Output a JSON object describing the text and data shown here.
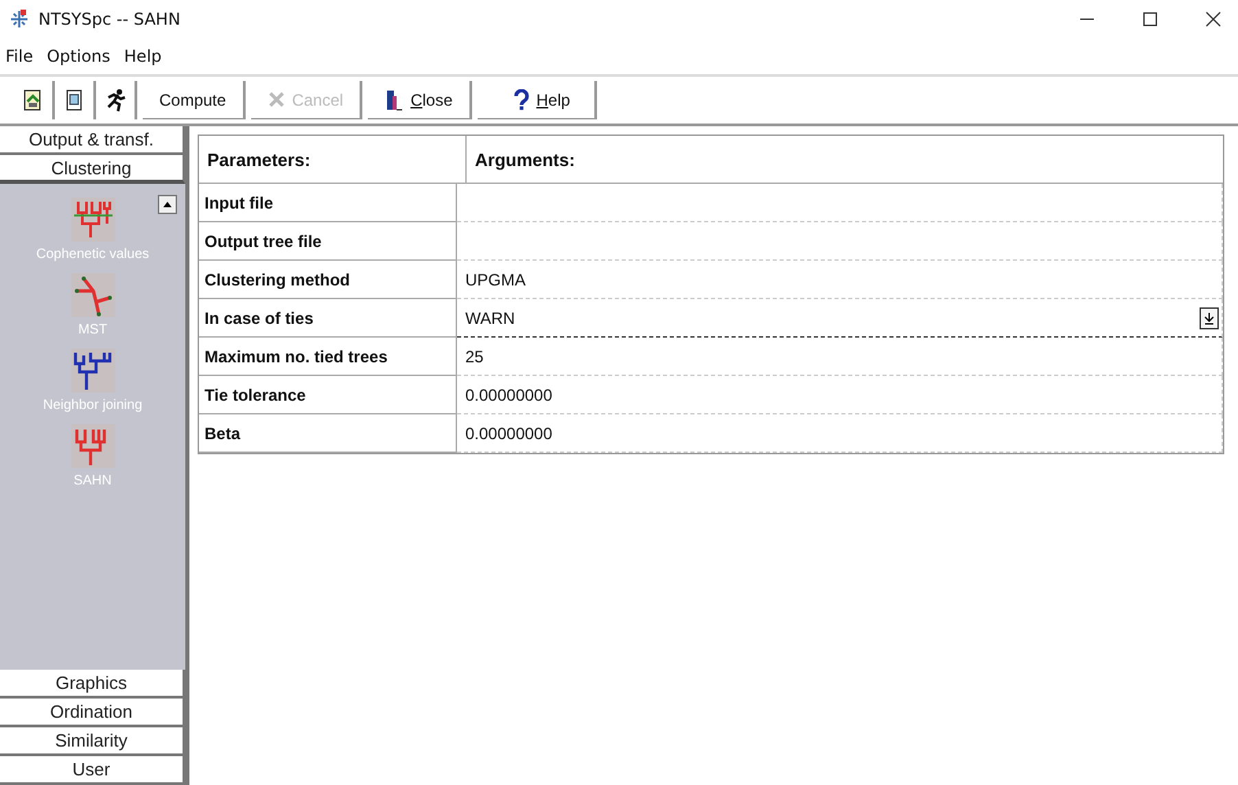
{
  "window": {
    "title": "NTSYSpc -- SAHN"
  },
  "menu": [
    "File",
    "Options",
    "Help"
  ],
  "toolbar": {
    "icon_buttons": [
      {
        "kind": "import"
      },
      {
        "kind": "notepad"
      },
      {
        "kind": "run"
      }
    ],
    "buttons": [
      {
        "label": "Compute",
        "kind": "plain",
        "disabled": false,
        "underline_first": false
      },
      {
        "label": "Cancel",
        "kind": "cancel",
        "disabled": true,
        "underline_first": false
      },
      {
        "label": "Close",
        "kind": "close",
        "disabled": false,
        "underline_first": true
      },
      {
        "label": "Help",
        "kind": "help",
        "disabled": false,
        "underline_first": true
      }
    ]
  },
  "sidebar": {
    "groups": [
      {
        "label": "Output & transf.",
        "expanded": false
      },
      {
        "label": "Clustering",
        "expanded": true,
        "items": [
          {
            "label": "Cophenetic values",
            "kind": "cophenetic"
          },
          {
            "label": "MST",
            "kind": "mst"
          },
          {
            "label": "Neighbor joining",
            "kind": "nj"
          },
          {
            "label": "SAHN",
            "kind": "sahn"
          }
        ]
      },
      {
        "label": "Graphics",
        "expanded": false
      },
      {
        "label": "Ordination",
        "expanded": false
      },
      {
        "label": "Similarity",
        "expanded": false
      },
      {
        "label": "User",
        "expanded": false
      }
    ]
  },
  "table": {
    "columns": [
      "Parameters:",
      "Arguments:"
    ],
    "rows": [
      {
        "parameter": "Input file",
        "kind": "text",
        "focused": false
      },
      {
        "parameter": "Output tree file",
        "kind": "text",
        "focused": false
      },
      {
        "parameter": "Clustering method",
        "argument": "UPGMA",
        "kind": "text",
        "focused": false
      },
      {
        "parameter": "In case of ties",
        "argument": "WARN",
        "kind": "dropdown",
        "focused": true
      },
      {
        "parameter": "Maximum no. tied trees",
        "argument": "25",
        "kind": "text",
        "focused": false
      },
      {
        "parameter": "Tie tolerance",
        "argument": "0.00000000",
        "kind": "text",
        "focused": false
      },
      {
        "parameter": "Beta",
        "argument": "0.00000000",
        "kind": "text",
        "focused": false
      }
    ]
  }
}
